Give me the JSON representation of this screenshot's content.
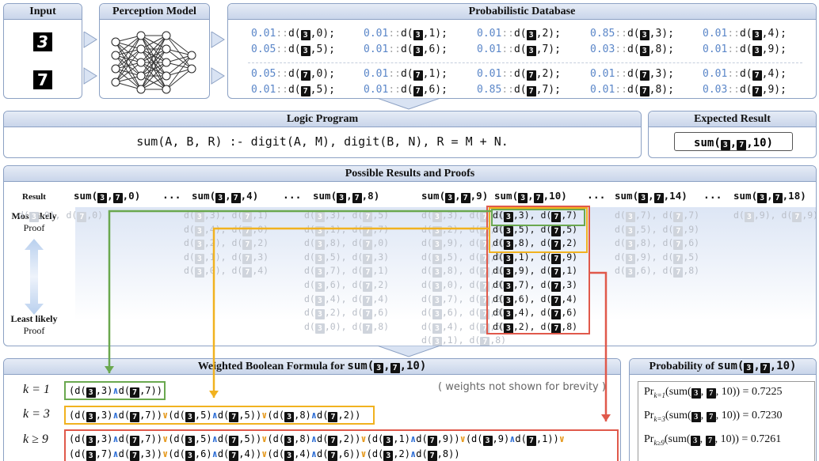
{
  "input": {
    "title": "Input",
    "digits": [
      "3",
      "7"
    ]
  },
  "perception": {
    "title": "Perception Model"
  },
  "database": {
    "title": "Probabilistic Database",
    "rows": [
      [
        {
          "p": "0.01",
          "img": "3",
          "v": "0"
        },
        {
          "p": "0.01",
          "img": "3",
          "v": "1"
        },
        {
          "p": "0.01",
          "img": "3",
          "v": "2"
        },
        {
          "p": "0.85",
          "img": "3",
          "v": "3"
        },
        {
          "p": "0.01",
          "img": "3",
          "v": "4"
        }
      ],
      [
        {
          "p": "0.05",
          "img": "3",
          "v": "5"
        },
        {
          "p": "0.01",
          "img": "3",
          "v": "6"
        },
        {
          "p": "0.01",
          "img": "3",
          "v": "7"
        },
        {
          "p": "0.03",
          "img": "3",
          "v": "8"
        },
        {
          "p": "0.01",
          "img": "3",
          "v": "9"
        }
      ],
      [
        {
          "p": "0.05",
          "img": "7",
          "v": "0"
        },
        {
          "p": "0.01",
          "img": "7",
          "v": "1"
        },
        {
          "p": "0.01",
          "img": "7",
          "v": "2"
        },
        {
          "p": "0.01",
          "img": "7",
          "v": "3"
        },
        {
          "p": "0.01",
          "img": "7",
          "v": "4"
        }
      ],
      [
        {
          "p": "0.01",
          "img": "7",
          "v": "5"
        },
        {
          "p": "0.01",
          "img": "7",
          "v": "6"
        },
        {
          "p": "0.85",
          "img": "7",
          "v": "7"
        },
        {
          "p": "0.01",
          "img": "7",
          "v": "8"
        },
        {
          "p": "0.03",
          "img": "7",
          "v": "9"
        }
      ]
    ]
  },
  "logic": {
    "title": "Logic Program",
    "rule": "sum(A, B, R) :- digit(A, M), digit(B, N), R = M + N."
  },
  "expected": {
    "title": "Expected Result",
    "value": "10"
  },
  "results": {
    "title": "Possible Results and Proofs",
    "result_label": "Result",
    "most_label": "Most likely",
    "least_label": "Least likely",
    "proof_label": "Proof",
    "columns": [
      {
        "r": "0",
        "proofs": [
          [
            "0",
            "0"
          ]
        ]
      },
      {
        "r": "4",
        "proofs": [
          [
            "3",
            "1"
          ],
          [
            "4",
            "0"
          ],
          [
            "2",
            "2"
          ],
          [
            "1",
            "3"
          ],
          [
            "0",
            "4"
          ]
        ]
      },
      {
        "r": "8",
        "proofs": [
          [
            "3",
            "5"
          ],
          [
            "1",
            "7"
          ],
          [
            "8",
            "0"
          ],
          [
            "5",
            "3"
          ],
          [
            "7",
            "1"
          ],
          [
            "6",
            "2"
          ],
          [
            "4",
            "4"
          ],
          [
            "2",
            "6"
          ],
          [
            "0",
            "8"
          ]
        ]
      },
      {
        "r": "9",
        "proofs": [
          [
            "3",
            "6"
          ],
          [
            "2",
            "7"
          ],
          [
            "9",
            "0"
          ],
          [
            "5",
            "4"
          ],
          [
            "8",
            "1"
          ],
          [
            "0",
            "9"
          ],
          [
            "7",
            "2"
          ],
          [
            "6",
            "3"
          ],
          [
            "4",
            "5"
          ],
          [
            "1",
            "8"
          ]
        ]
      },
      {
        "r": "10",
        "proofs": [
          [
            "3",
            "7"
          ],
          [
            "5",
            "5"
          ],
          [
            "8",
            "2"
          ],
          [
            "1",
            "9"
          ],
          [
            "9",
            "1"
          ],
          [
            "7",
            "3"
          ],
          [
            "6",
            "4"
          ],
          [
            "4",
            "6"
          ],
          [
            "2",
            "8"
          ]
        ]
      },
      {
        "r": "14",
        "proofs": [
          [
            "7",
            "7"
          ],
          [
            "5",
            "9"
          ],
          [
            "8",
            "6"
          ],
          [
            "9",
            "5"
          ],
          [
            "6",
            "8"
          ]
        ]
      },
      {
        "r": "18",
        "proofs": [
          [
            "9",
            "9"
          ]
        ]
      }
    ],
    "ellipsis": "..."
  },
  "formula": {
    "title": "Weighted Boolean Formula for",
    "note": "( weights not shown for brevity )",
    "k_labels": [
      "k = 1",
      "k = 3",
      "k ≥ 9"
    ]
  },
  "probability": {
    "title": "Probability of",
    "values": [
      {
        "k": "k=1",
        "v": "0.7225"
      },
      {
        "k": "k=3",
        "v": "0.7230"
      },
      {
        "k": "k≥9",
        "v": "0.7261"
      }
    ]
  },
  "colors": {
    "green": "#6aa84f",
    "yellow": "#f1b21f",
    "red": "#e0594b",
    "border": "#8ca1c4"
  }
}
